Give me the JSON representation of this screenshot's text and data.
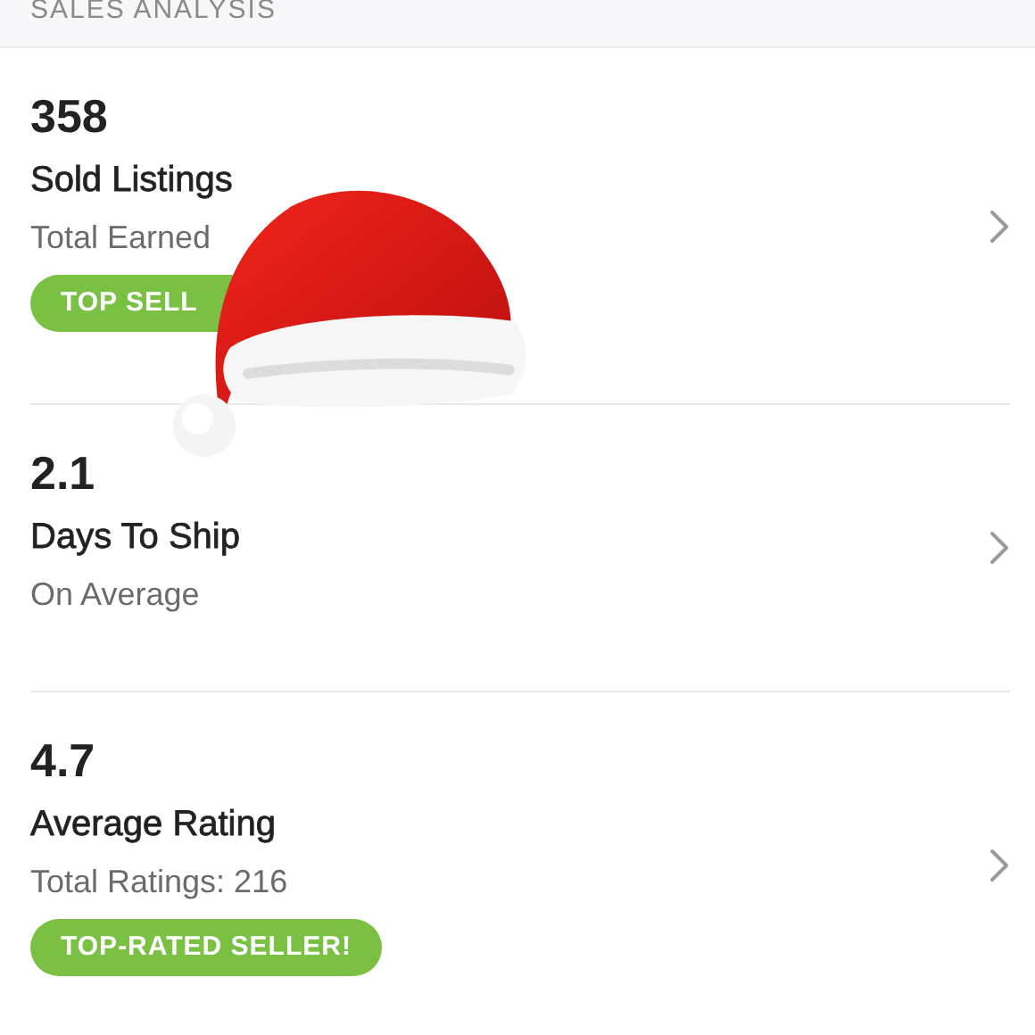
{
  "header": {
    "title": "SALES ANALYSIS"
  },
  "stats": [
    {
      "value": "358",
      "title": "Sold Listings",
      "subtitle": "Total Earned",
      "badge": "TOP SELL"
    },
    {
      "value": "2.1",
      "title": "Days To Ship",
      "subtitle": "On Average"
    },
    {
      "value": "4.7",
      "title": "Average Rating",
      "subtitle": "Total Ratings: 216",
      "badge": "TOP-RATED SELLER!"
    }
  ]
}
